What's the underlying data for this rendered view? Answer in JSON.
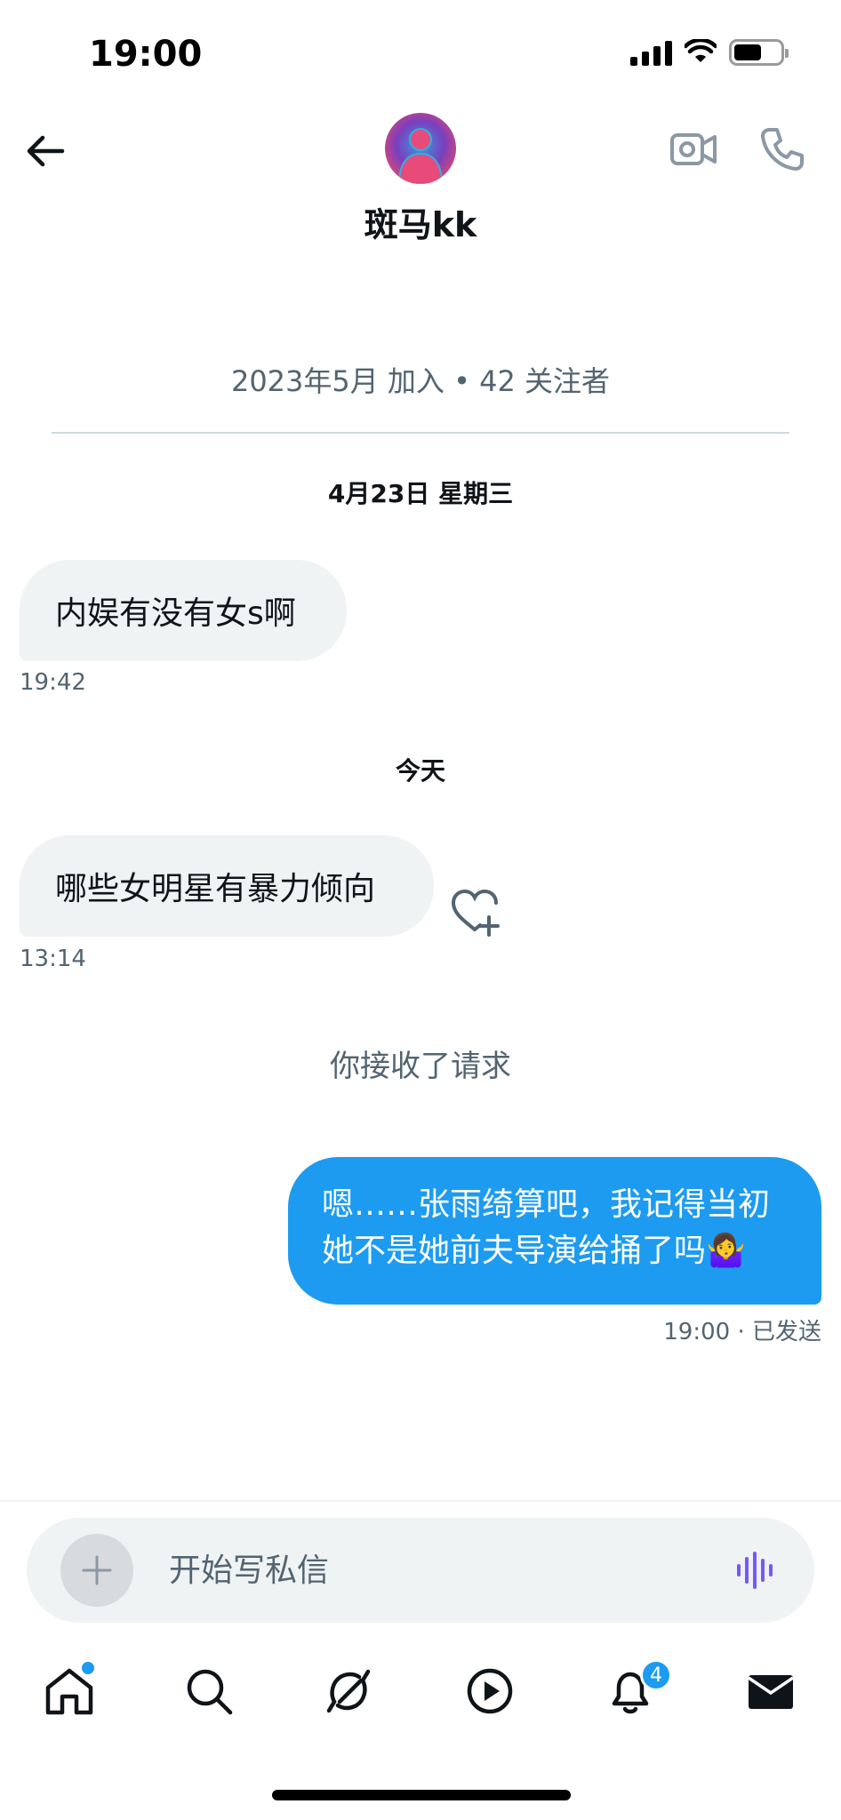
{
  "status_bar": {
    "time": "19:00"
  },
  "header": {
    "contact_name": "斑马kk"
  },
  "profile_meta": "2023年5月 加入 • 42 关注者",
  "conversation": {
    "date_1": "4月23日 星期三",
    "message_1": {
      "text": "内娱有没有女s啊",
      "time": "19:42"
    },
    "date_2": "今天",
    "message_2": {
      "text": "哪些女明星有暴力倾向",
      "time": "13:14"
    },
    "request_notice": "你接收了请求",
    "sent_message": {
      "line_1": "嗯……张雨绮算吧，我记得当初",
      "line_2": "她不是她前夫导演给捅了吗🤷‍♀️",
      "time": "19:00",
      "status": "· 已发送"
    }
  },
  "composer": {
    "placeholder": "开始写私信"
  },
  "tab_bar": {
    "items": [
      "home-icon",
      "search-icon",
      "grok-icon",
      "video-icon",
      "notifications-icon",
      "messages-icon"
    ],
    "notifications_badge": "4"
  },
  "colors": {
    "accent": "#1d9bf0",
    "incoming_bubble": "#eff3f4",
    "muted_text": "#536471",
    "voice_icon": "#7856ff"
  }
}
